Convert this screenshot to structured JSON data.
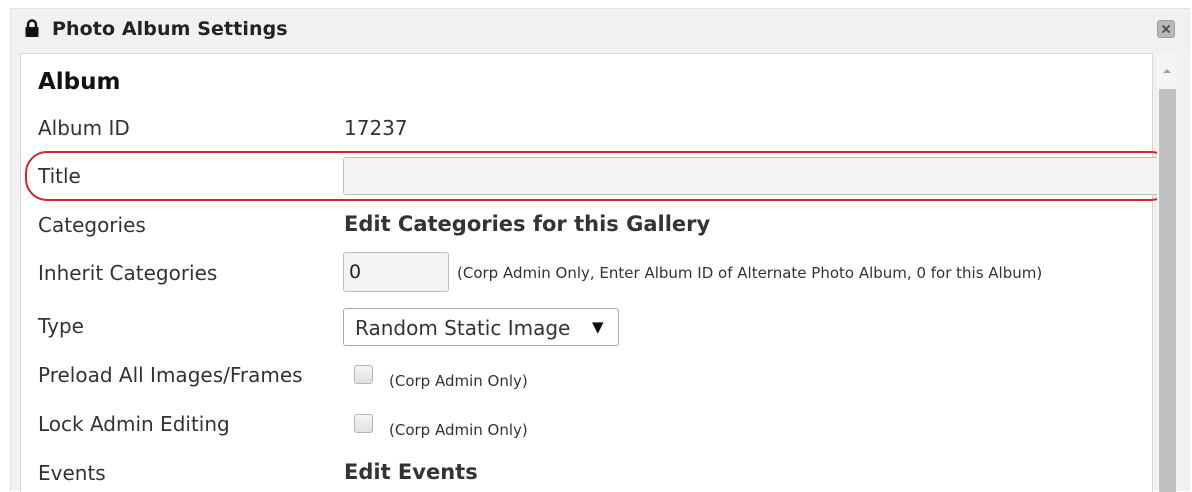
{
  "dialog": {
    "title": "Photo Album Settings",
    "close_icon": "close-icon",
    "lock_icon": "lock-icon"
  },
  "section": {
    "title": "Album"
  },
  "fields": {
    "album_id": {
      "label": "Album ID",
      "value": "17237"
    },
    "title": {
      "label": "Title",
      "value": ""
    },
    "categories": {
      "label": "Categories",
      "link": "Edit Categories for this Gallery"
    },
    "inherit_categories": {
      "label": "Inherit Categories",
      "value": "0",
      "hint": "(Corp Admin Only, Enter Album ID of Alternate Photo Album, 0 for this Album)"
    },
    "type": {
      "label": "Type",
      "selected": "Random Static Image",
      "arrow": "▼"
    },
    "preload": {
      "label": "Preload All Images/Frames",
      "hint": "(Corp Admin Only)",
      "checked": false
    },
    "lock_admin": {
      "label": "Lock Admin Editing",
      "hint": "(Corp Admin Only)",
      "checked": false
    },
    "events": {
      "label": "Events",
      "link": "Edit Events"
    }
  },
  "colors": {
    "highlight": "#d9232d",
    "titlebar_bg": "#f1f1f1"
  }
}
